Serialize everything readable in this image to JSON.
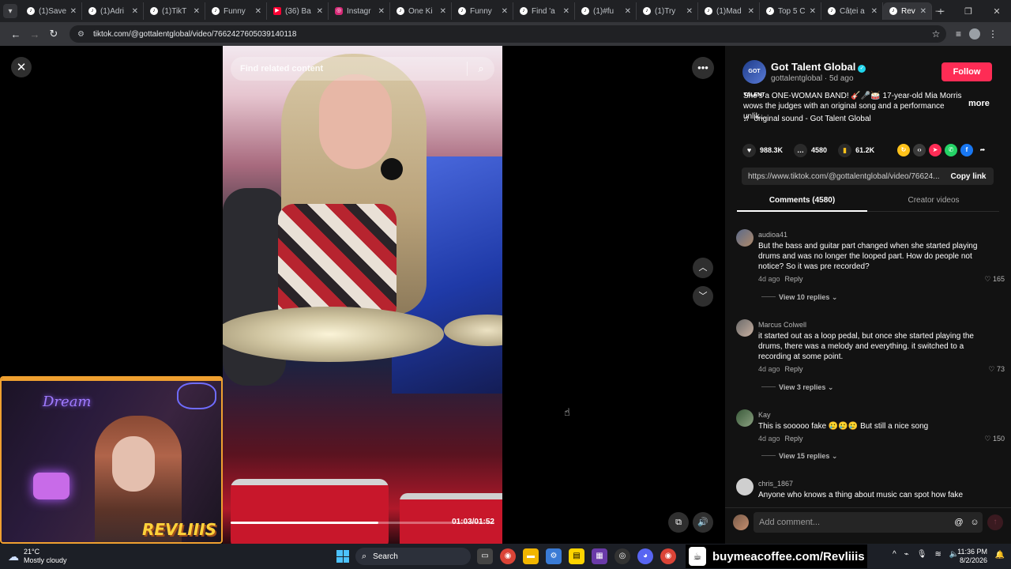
{
  "browser": {
    "tabs": [
      {
        "label": "(1)Save",
        "icon": "tiktok"
      },
      {
        "label": "(1)Adri",
        "icon": "tiktok"
      },
      {
        "label": "(1)TikT",
        "icon": "tiktok"
      },
      {
        "label": "Funny",
        "icon": "tiktok"
      },
      {
        "label": "(36) Ba",
        "icon": "youtube"
      },
      {
        "label": "Instagr",
        "icon": "instagram"
      },
      {
        "label": "One Ki",
        "icon": "tiktok"
      },
      {
        "label": "Funny",
        "icon": "tiktok"
      },
      {
        "label": "Find 'a",
        "icon": "tiktok"
      },
      {
        "label": "(1)#fu",
        "icon": "tiktok"
      },
      {
        "label": "(1)Try",
        "icon": "tiktok"
      },
      {
        "label": "(1)Mad",
        "icon": "tiktok"
      },
      {
        "label": "Top 5 C",
        "icon": "tiktok"
      },
      {
        "label": "Câței a",
        "icon": "tiktok"
      },
      {
        "label": "Rev",
        "icon": "tiktok",
        "active": true
      }
    ],
    "url": "tiktok.com/@gottalentglobal/video/7662427605039140118"
  },
  "video": {
    "search_placeholder": "Find related content",
    "timecode": "01:03/01:52",
    "progress": 0.56
  },
  "post": {
    "author_name": "Got Talent Global",
    "author_handle": "gottalentglobal",
    "posted": "5d ago",
    "avatar_text": "GOT TALENT",
    "follow_label": "Follow",
    "description": "She's a ONE-WOMAN BAND! 🎸🎤🥁 17-year-old Mia Morris wows the judges with an original song and a performance unlik...",
    "more_label": "more",
    "sound": "original sound - Got Talent Global",
    "likes": "988.3K",
    "comments": "4580",
    "saves": "61.2K",
    "link": "https://www.tiktok.com/@gottalentglobal/video/76624...",
    "copy_label": "Copy link",
    "accent": "#fe2c55"
  },
  "tabs": {
    "comments": "Comments (4580)",
    "creator": "Creator videos"
  },
  "comments": [
    {
      "user": "audioa41",
      "text": "But the bass and guitar part changed when she started playing drums and was no longer the looped part. How do people not notice? So it was pre recorded?",
      "time": "4d ago",
      "reply": "Reply",
      "likes": "165",
      "replies": "View 10 replies"
    },
    {
      "user": "Marcus Colwell",
      "text": "it started out as a loop pedal, but once she started playing the drums, there was a melody and everything. it switched to a recording at some point.",
      "time": "4d ago",
      "reply": "Reply",
      "likes": "73",
      "replies": "View 3 replies"
    },
    {
      "user": "Kay",
      "text": "This is sooooo fake 🥲🥲🥲 But still a nice song",
      "time": "4d ago",
      "reply": "Reply",
      "likes": "150",
      "replies": "View 15 replies"
    },
    {
      "user": "chris_1867",
      "text": "Anyone who knows a thing about music can spot how fake",
      "time": "",
      "reply": "",
      "likes": "",
      "replies": ""
    }
  ],
  "composer": {
    "placeholder": "Add comment..."
  },
  "webcam": {
    "neon_text": "Dream",
    "brand": "REVLIIIS"
  },
  "taskbar": {
    "temp": "21°C",
    "weather": "Mostly cloudy",
    "search_label": "Search",
    "promo": "buymeacoffee.com/Revliiis",
    "time": "11:36 PM",
    "date": "8/2/2026"
  }
}
